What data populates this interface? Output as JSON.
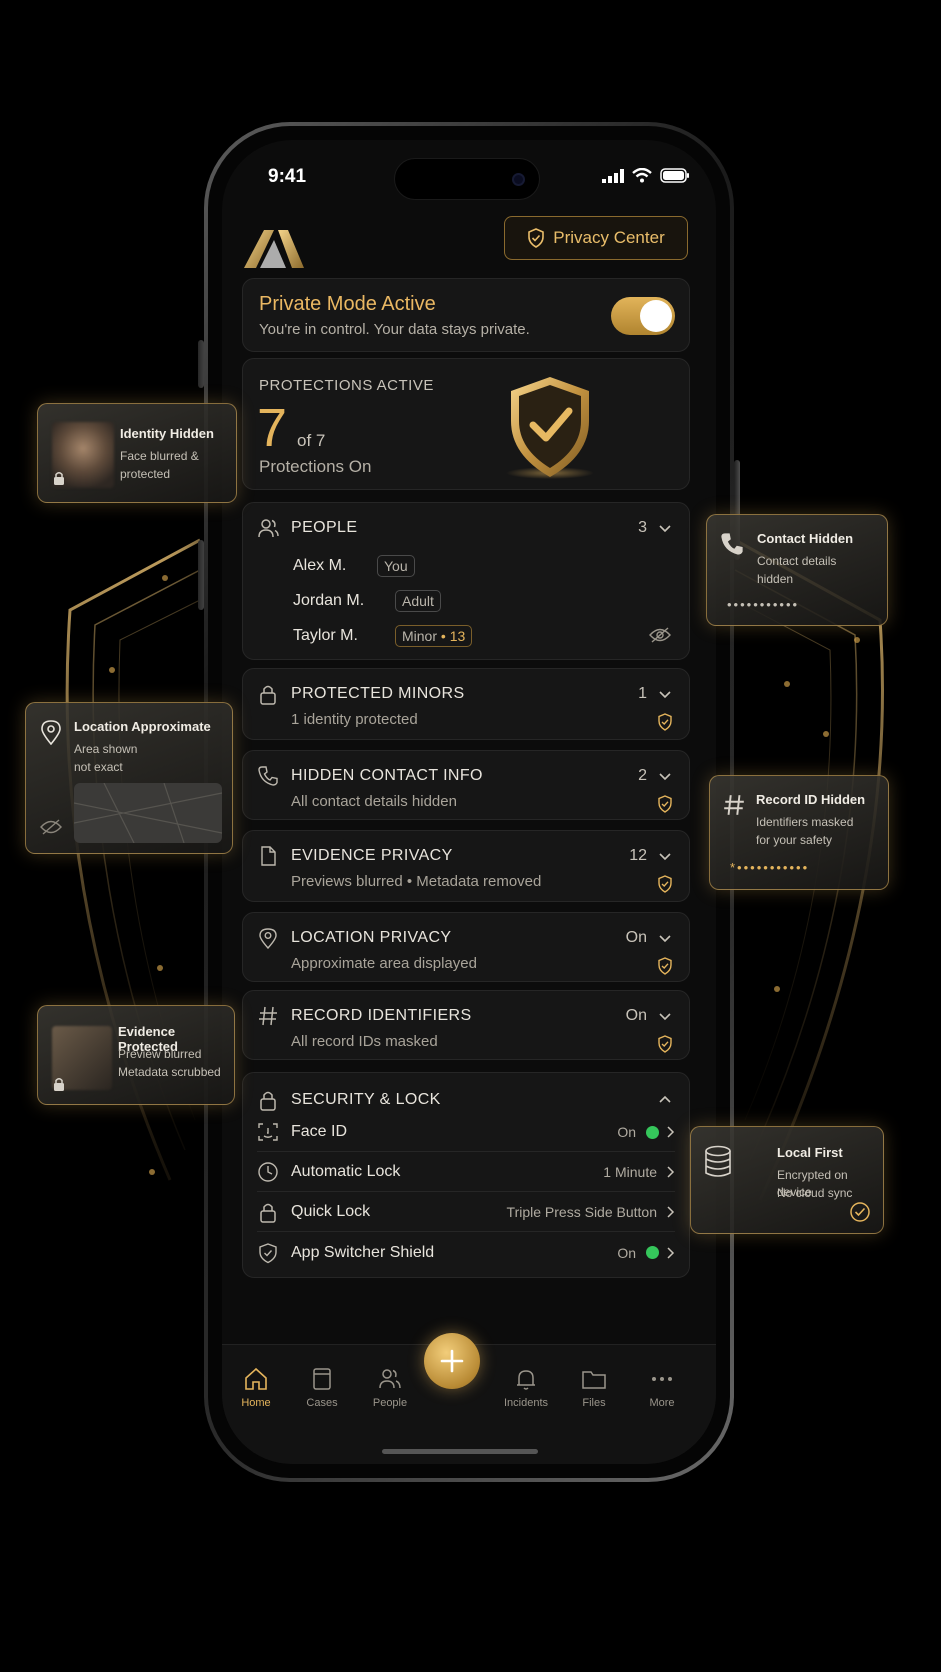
{
  "status_bar": {
    "time": "9:41"
  },
  "header": {
    "privacy_center_label": "Privacy Center"
  },
  "private_mode": {
    "title": "Private Mode Active",
    "subtitle": "You're in control. Your data stays private.",
    "enabled": true
  },
  "protections": {
    "heading": "PROTECTIONS ACTIVE",
    "count": "7",
    "of_total": "of 7",
    "caption": "Protections On"
  },
  "people": {
    "title": "PEOPLE",
    "count": "3",
    "list": [
      {
        "name": "Alex M.",
        "tag": "You"
      },
      {
        "name": "Jordan M.",
        "tag": "Adult"
      },
      {
        "name": "Taylor M.",
        "tag": "Minor",
        "tag_extra": "• 13"
      }
    ]
  },
  "sections": [
    {
      "title": "PROTECTED MINORS",
      "subtitle": "1 identity protected",
      "value": "1",
      "icon": "lock-icon"
    },
    {
      "title": "HIDDEN CONTACT INFO",
      "subtitle": "All contact details hidden",
      "value": "2",
      "icon": "phone-icon"
    },
    {
      "title": "EVIDENCE PRIVACY",
      "subtitle": "Previews blurred • Metadata removed",
      "value": "12",
      "icon": "document-icon"
    },
    {
      "title": "LOCATION PRIVACY",
      "subtitle": "Approximate area displayed",
      "value": "On",
      "icon": "location-pin-icon"
    },
    {
      "title": "RECORD IDENTIFIERS",
      "subtitle": "All record IDs masked",
      "value": "On",
      "icon": "hash-icon"
    }
  ],
  "security": {
    "title": "SECURITY & LOCK",
    "rows": [
      {
        "label": "Face ID",
        "value": "On",
        "status_dot": true,
        "icon": "face-id-icon"
      },
      {
        "label": "Automatic Lock",
        "value": "1 Minute",
        "status_dot": false,
        "icon": "clock-icon"
      },
      {
        "label": "Quick Lock",
        "value": "Triple Press Side Button",
        "status_dot": false,
        "icon": "lock-icon"
      },
      {
        "label": "App Switcher Shield",
        "value": "On",
        "status_dot": true,
        "icon": "shield-check-icon"
      }
    ]
  },
  "nav": {
    "items": [
      {
        "label": "Home",
        "icon": "home-icon",
        "active": true
      },
      {
        "label": "Cases",
        "icon": "cases-icon"
      },
      {
        "label": "People",
        "icon": "people-icon"
      },
      {
        "label": "Incidents",
        "icon": "bell-icon"
      },
      {
        "label": "Files",
        "icon": "folder-icon"
      },
      {
        "label": "More",
        "icon": "more-icon"
      }
    ]
  },
  "callouts": {
    "identity": {
      "title": "Identity Hidden",
      "line1": "Face blurred &",
      "line2": "protected"
    },
    "location": {
      "title": "Location Approximate",
      "line1": "Area shown",
      "line2": "not exact"
    },
    "evidence": {
      "title": "Evidence Protected",
      "line1": "Preview blurred",
      "line2": "Metadata scrubbed"
    },
    "contact": {
      "title": "Contact Hidden",
      "line1": "Contact details",
      "line2": "hidden",
      "mask": "•••••••••••"
    },
    "record": {
      "title": "Record ID Hidden",
      "line1": "Identifiers masked",
      "line2": "for your safety",
      "mask": "*•••••••••••"
    },
    "local": {
      "title": "Local First",
      "line1": "Encrypted on device",
      "line2": "No cloud sync"
    }
  },
  "colors": {
    "accent": "#e4b45c",
    "background": "#000000",
    "card": "#161616",
    "status_on": "#35c65b"
  }
}
